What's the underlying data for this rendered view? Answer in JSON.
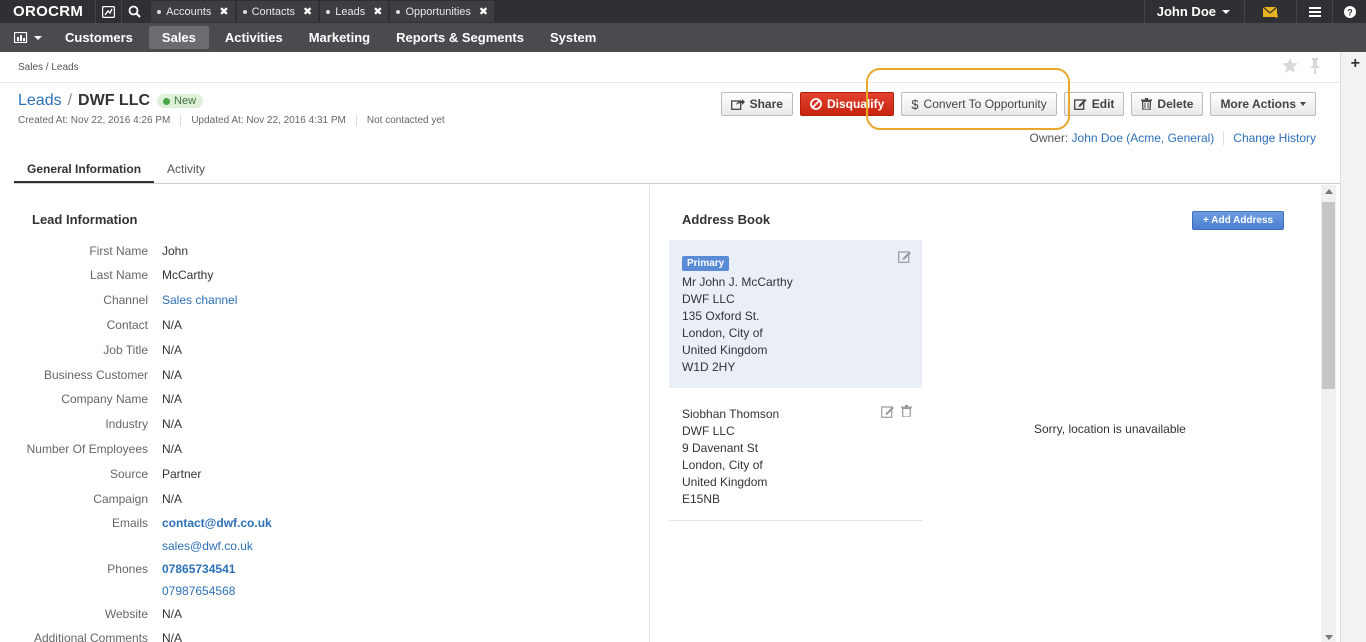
{
  "app": {
    "logo": "OROCRM",
    "pinned_tabs": [
      {
        "label": "Accounts"
      },
      {
        "label": "Contacts"
      },
      {
        "label": "Leads"
      },
      {
        "label": "Opportunities"
      }
    ],
    "user_name": "John Doe",
    "icons": {
      "dashboard": "bar-chart-icon",
      "search": "search-icon",
      "mail": "envelope-icon",
      "menu": "hamburger-icon",
      "help": "question-icon"
    }
  },
  "nav": {
    "items": [
      "Customers",
      "Sales",
      "Activities",
      "Marketing",
      "Reports & Segments",
      "System"
    ],
    "active": "Sales"
  },
  "breadcrumb": "Sales / Leads",
  "header": {
    "crumb": "Leads",
    "separator": "/",
    "name": "DWF LLC",
    "status": "New",
    "created": "Created At: Nov 22, 2016 4:26 PM",
    "updated": "Updated At: Nov 22, 2016 4:31 PM",
    "contacted": "Not contacted yet",
    "buttons": {
      "share": "Share",
      "disqualify": "Disqualify",
      "convert": "Convert To Opportunity",
      "edit": "Edit",
      "delete": "Delete",
      "more": "More Actions"
    },
    "owner_label": "Owner:",
    "owner_name": "John Doe",
    "owner_org": "(Acme, General)",
    "change_history": "Change History"
  },
  "tabs": [
    "General Information",
    "Activity"
  ],
  "lead_info": {
    "title": "Lead Information",
    "fields": [
      {
        "label": "First Name",
        "value": "John",
        "style": "plain"
      },
      {
        "label": "Last Name",
        "value": "McCarthy",
        "style": "plain"
      },
      {
        "label": "Channel",
        "value": "Sales channel",
        "style": "link"
      },
      {
        "label": "Contact",
        "value": "N/A",
        "style": "plain"
      },
      {
        "label": "Job Title",
        "value": "N/A",
        "style": "plain"
      },
      {
        "label": "Business Customer",
        "value": "N/A",
        "style": "plain"
      },
      {
        "label": "Company Name",
        "value": "N/A",
        "style": "plain"
      },
      {
        "label": "Industry",
        "value": "N/A",
        "style": "plain"
      },
      {
        "label": "Number Of Employees",
        "value": "N/A",
        "style": "plain"
      },
      {
        "label": "Source",
        "value": "Partner",
        "style": "plain"
      },
      {
        "label": "Campaign",
        "value": "N/A",
        "style": "plain"
      },
      {
        "label": "Emails",
        "value": "contact@dwf.co.uk",
        "style": "bold-link"
      },
      {
        "label": "",
        "value": "sales@dwf.co.uk",
        "style": "link"
      },
      {
        "label": "Phones",
        "value": "07865734541",
        "style": "bold-link"
      },
      {
        "label": "",
        "value": "07987654568",
        "style": "link"
      },
      {
        "label": "Website",
        "value": "N/A",
        "style": "plain"
      },
      {
        "label": "Additional Comments",
        "value": "N/A",
        "style": "plain"
      }
    ]
  },
  "address_book": {
    "title": "Address Book",
    "add_button": "+ Add Address",
    "primary_label": "Primary",
    "addresses": [
      {
        "lines": [
          "Mr John J. McCarthy",
          "DWF LLC",
          "135 Oxford St.",
          "London, City of",
          "United Kingdom",
          "W1D 2HY"
        ]
      },
      {
        "lines": [
          "Siobhan Thomson",
          "DWF LLC",
          "9 Davenant St",
          "London, City of",
          "United Kingdom",
          "E15NB"
        ]
      }
    ],
    "map_message": "Sorry, location is unavailable"
  }
}
